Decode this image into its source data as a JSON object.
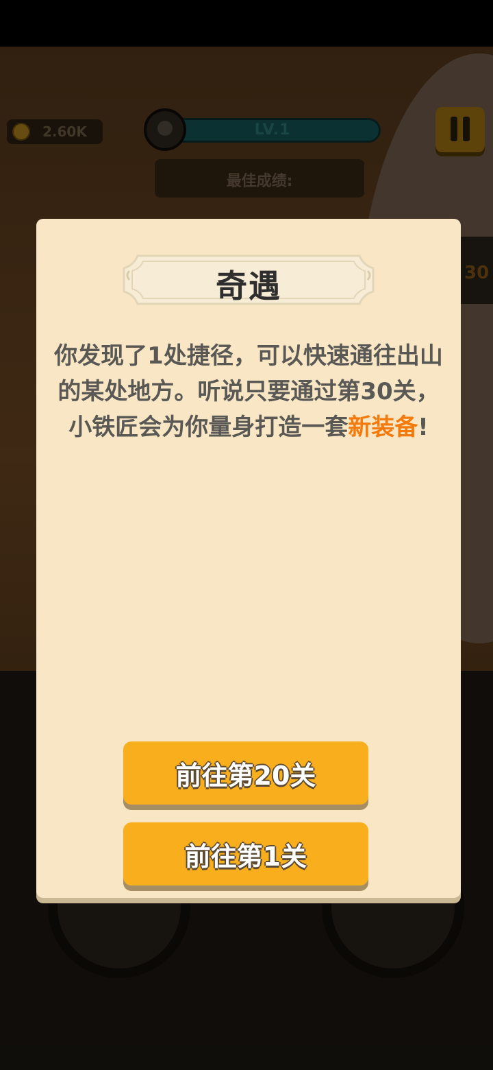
{
  "hud": {
    "coins": "2.60K",
    "level": "LV.1",
    "best_score_label": "最佳成绩:",
    "side_number": "30"
  },
  "dialog": {
    "title": "奇遇",
    "message_main": "你发现了1处捷径，可以快速通往出山的某处地方。听说只要通过第30关，小铁匠会为你量身打造一套",
    "message_highlight": "新装备",
    "message_end": "!",
    "highlight_color": "#f47a0c",
    "buttons": [
      {
        "label": "前往第20关"
      },
      {
        "label": "前往第1关"
      }
    ]
  }
}
